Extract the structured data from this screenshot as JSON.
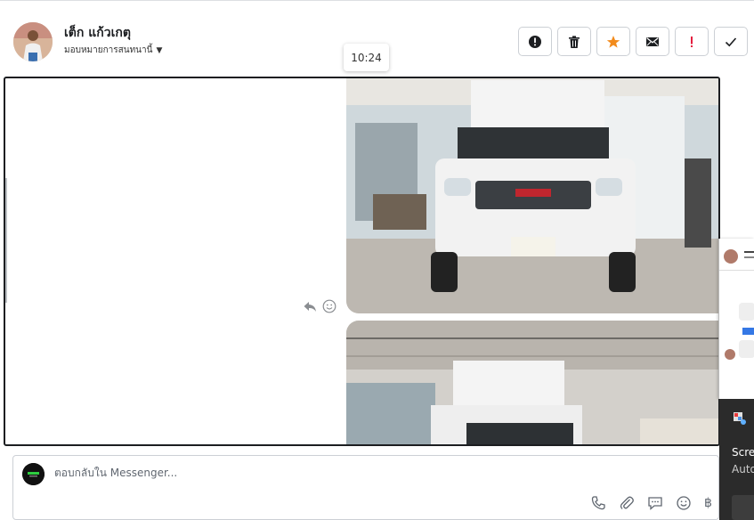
{
  "header": {
    "contact_name": "เต็ก แก้วเกตุ",
    "assign_label": "มอบหมายการสนทนานี้",
    "tooltip_time": "10:24"
  },
  "actions": [
    {
      "name": "mark-spam-button",
      "icon": "alert-circle-icon"
    },
    {
      "name": "delete-button",
      "icon": "trash-icon"
    },
    {
      "name": "star-button",
      "icon": "star-icon"
    },
    {
      "name": "mark-unread-button",
      "icon": "envelope-icon"
    },
    {
      "name": "follow-up-button",
      "icon": "exclamation-icon"
    },
    {
      "name": "mark-done-button",
      "icon": "check-icon"
    }
  ],
  "colors": {
    "star": "#f28b1c",
    "follow_up": "#e41e3f",
    "border": "#ccd0d5"
  },
  "composer": {
    "placeholder": "ตอบกลับใน Messenger..."
  },
  "notification": {
    "line1": "Scre",
    "line2": "Auto"
  }
}
